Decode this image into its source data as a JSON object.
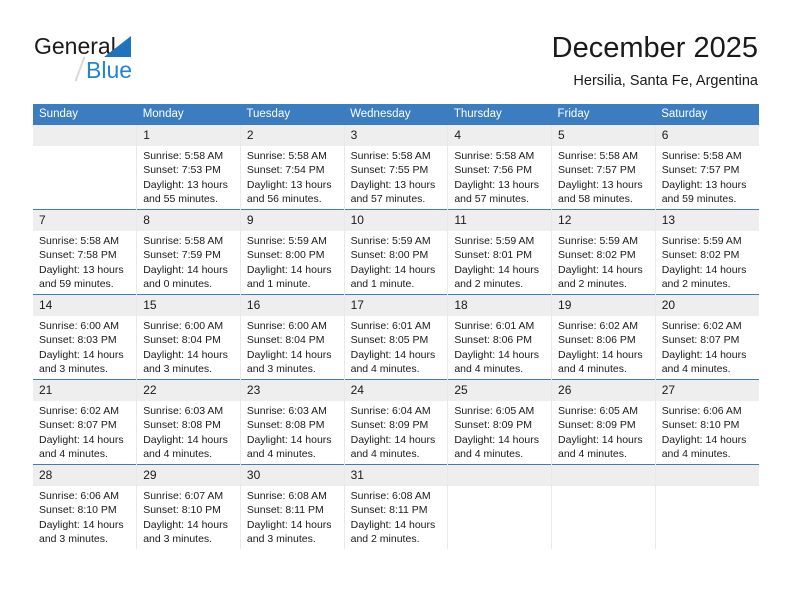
{
  "brand": {
    "name_part1": "General",
    "name_part2": "Blue",
    "triangle_color": "#1f72bd",
    "blue_color": "#2484d0"
  },
  "header": {
    "title": "December 2025",
    "subtitle": "Hersilia, Santa Fe, Argentina"
  },
  "theme": {
    "header_blue": "#3b7dc0",
    "daynum_gray": "#eeeeee",
    "cell_border": "#e9e9e9"
  },
  "calendar": {
    "weekday_headers": [
      "Sunday",
      "Monday",
      "Tuesday",
      "Wednesday",
      "Thursday",
      "Friday",
      "Saturday"
    ],
    "weeks": [
      [
        {
          "day": "",
          "lines": []
        },
        {
          "day": "1",
          "lines": [
            "Sunrise: 5:58 AM",
            "Sunset: 7:53 PM",
            "Daylight: 13 hours",
            "and 55 minutes."
          ]
        },
        {
          "day": "2",
          "lines": [
            "Sunrise: 5:58 AM",
            "Sunset: 7:54 PM",
            "Daylight: 13 hours",
            "and 56 minutes."
          ]
        },
        {
          "day": "3",
          "lines": [
            "Sunrise: 5:58 AM",
            "Sunset: 7:55 PM",
            "Daylight: 13 hours",
            "and 57 minutes."
          ]
        },
        {
          "day": "4",
          "lines": [
            "Sunrise: 5:58 AM",
            "Sunset: 7:56 PM",
            "Daylight: 13 hours",
            "and 57 minutes."
          ]
        },
        {
          "day": "5",
          "lines": [
            "Sunrise: 5:58 AM",
            "Sunset: 7:57 PM",
            "Daylight: 13 hours",
            "and 58 minutes."
          ]
        },
        {
          "day": "6",
          "lines": [
            "Sunrise: 5:58 AM",
            "Sunset: 7:57 PM",
            "Daylight: 13 hours",
            "and 59 minutes."
          ]
        }
      ],
      [
        {
          "day": "7",
          "lines": [
            "Sunrise: 5:58 AM",
            "Sunset: 7:58 PM",
            "Daylight: 13 hours",
            "and 59 minutes."
          ]
        },
        {
          "day": "8",
          "lines": [
            "Sunrise: 5:58 AM",
            "Sunset: 7:59 PM",
            "Daylight: 14 hours",
            "and 0 minutes."
          ]
        },
        {
          "day": "9",
          "lines": [
            "Sunrise: 5:59 AM",
            "Sunset: 8:00 PM",
            "Daylight: 14 hours",
            "and 1 minute."
          ]
        },
        {
          "day": "10",
          "lines": [
            "Sunrise: 5:59 AM",
            "Sunset: 8:00 PM",
            "Daylight: 14 hours",
            "and 1 minute."
          ]
        },
        {
          "day": "11",
          "lines": [
            "Sunrise: 5:59 AM",
            "Sunset: 8:01 PM",
            "Daylight: 14 hours",
            "and 2 minutes."
          ]
        },
        {
          "day": "12",
          "lines": [
            "Sunrise: 5:59 AM",
            "Sunset: 8:02 PM",
            "Daylight: 14 hours",
            "and 2 minutes."
          ]
        },
        {
          "day": "13",
          "lines": [
            "Sunrise: 5:59 AM",
            "Sunset: 8:02 PM",
            "Daylight: 14 hours",
            "and 2 minutes."
          ]
        }
      ],
      [
        {
          "day": "14",
          "lines": [
            "Sunrise: 6:00 AM",
            "Sunset: 8:03 PM",
            "Daylight: 14 hours",
            "and 3 minutes."
          ]
        },
        {
          "day": "15",
          "lines": [
            "Sunrise: 6:00 AM",
            "Sunset: 8:04 PM",
            "Daylight: 14 hours",
            "and 3 minutes."
          ]
        },
        {
          "day": "16",
          "lines": [
            "Sunrise: 6:00 AM",
            "Sunset: 8:04 PM",
            "Daylight: 14 hours",
            "and 3 minutes."
          ]
        },
        {
          "day": "17",
          "lines": [
            "Sunrise: 6:01 AM",
            "Sunset: 8:05 PM",
            "Daylight: 14 hours",
            "and 4 minutes."
          ]
        },
        {
          "day": "18",
          "lines": [
            "Sunrise: 6:01 AM",
            "Sunset: 8:06 PM",
            "Daylight: 14 hours",
            "and 4 minutes."
          ]
        },
        {
          "day": "19",
          "lines": [
            "Sunrise: 6:02 AM",
            "Sunset: 8:06 PM",
            "Daylight: 14 hours",
            "and 4 minutes."
          ]
        },
        {
          "day": "20",
          "lines": [
            "Sunrise: 6:02 AM",
            "Sunset: 8:07 PM",
            "Daylight: 14 hours",
            "and 4 minutes."
          ]
        }
      ],
      [
        {
          "day": "21",
          "lines": [
            "Sunrise: 6:02 AM",
            "Sunset: 8:07 PM",
            "Daylight: 14 hours",
            "and 4 minutes."
          ]
        },
        {
          "day": "22",
          "lines": [
            "Sunrise: 6:03 AM",
            "Sunset: 8:08 PM",
            "Daylight: 14 hours",
            "and 4 minutes."
          ]
        },
        {
          "day": "23",
          "lines": [
            "Sunrise: 6:03 AM",
            "Sunset: 8:08 PM",
            "Daylight: 14 hours",
            "and 4 minutes."
          ]
        },
        {
          "day": "24",
          "lines": [
            "Sunrise: 6:04 AM",
            "Sunset: 8:09 PM",
            "Daylight: 14 hours",
            "and 4 minutes."
          ]
        },
        {
          "day": "25",
          "lines": [
            "Sunrise: 6:05 AM",
            "Sunset: 8:09 PM",
            "Daylight: 14 hours",
            "and 4 minutes."
          ]
        },
        {
          "day": "26",
          "lines": [
            "Sunrise: 6:05 AM",
            "Sunset: 8:09 PM",
            "Daylight: 14 hours",
            "and 4 minutes."
          ]
        },
        {
          "day": "27",
          "lines": [
            "Sunrise: 6:06 AM",
            "Sunset: 8:10 PM",
            "Daylight: 14 hours",
            "and 4 minutes."
          ]
        }
      ],
      [
        {
          "day": "28",
          "lines": [
            "Sunrise: 6:06 AM",
            "Sunset: 8:10 PM",
            "Daylight: 14 hours",
            "and 3 minutes."
          ]
        },
        {
          "day": "29",
          "lines": [
            "Sunrise: 6:07 AM",
            "Sunset: 8:10 PM",
            "Daylight: 14 hours",
            "and 3 minutes."
          ]
        },
        {
          "day": "30",
          "lines": [
            "Sunrise: 6:08 AM",
            "Sunset: 8:11 PM",
            "Daylight: 14 hours",
            "and 3 minutes."
          ]
        },
        {
          "day": "31",
          "lines": [
            "Sunrise: 6:08 AM",
            "Sunset: 8:11 PM",
            "Daylight: 14 hours",
            "and 2 minutes."
          ]
        },
        {
          "day": "",
          "lines": []
        },
        {
          "day": "",
          "lines": []
        },
        {
          "day": "",
          "lines": []
        }
      ]
    ]
  }
}
